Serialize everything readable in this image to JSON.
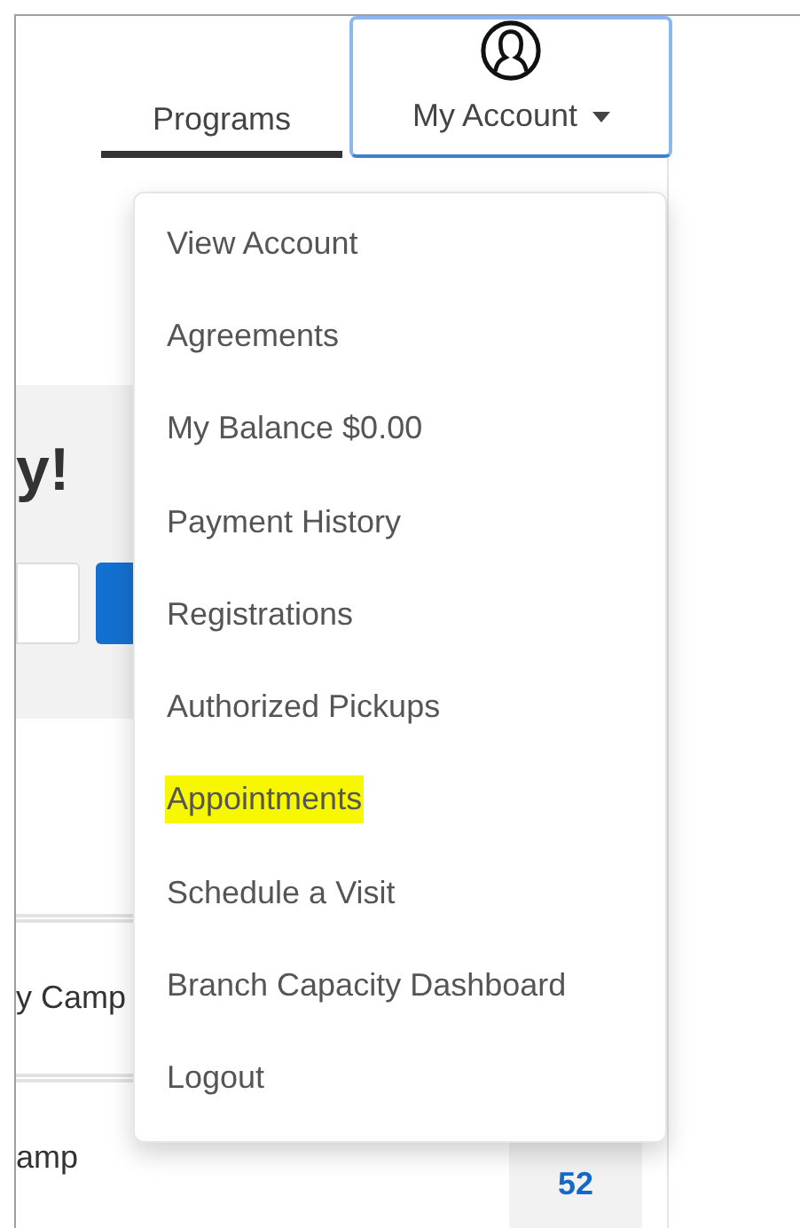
{
  "nav": {
    "tabs": [
      {
        "label": "Programs",
        "selected": true
      },
      {
        "label": "My Account",
        "selected": false,
        "expanded": true
      }
    ]
  },
  "background": {
    "heading": "y!",
    "rows": [
      {
        "label": "y Camp"
      },
      {
        "label": "amp",
        "count": "52"
      }
    ]
  },
  "account_menu": {
    "items": [
      {
        "label": "View Account",
        "highlighted": false
      },
      {
        "label": "Agreements",
        "highlighted": false
      },
      {
        "label": "My Balance $0.00",
        "highlighted": false
      },
      {
        "label": "Payment History",
        "highlighted": false
      },
      {
        "label": "Registrations",
        "highlighted": false
      },
      {
        "label": "Authorized Pickups",
        "highlighted": false
      },
      {
        "label": "Appointments",
        "highlighted": true
      },
      {
        "label": "Schedule a Visit",
        "highlighted": false
      },
      {
        "label": "Branch Capacity Dashboard",
        "highlighted": false
      },
      {
        "label": "Logout",
        "highlighted": false
      }
    ]
  }
}
